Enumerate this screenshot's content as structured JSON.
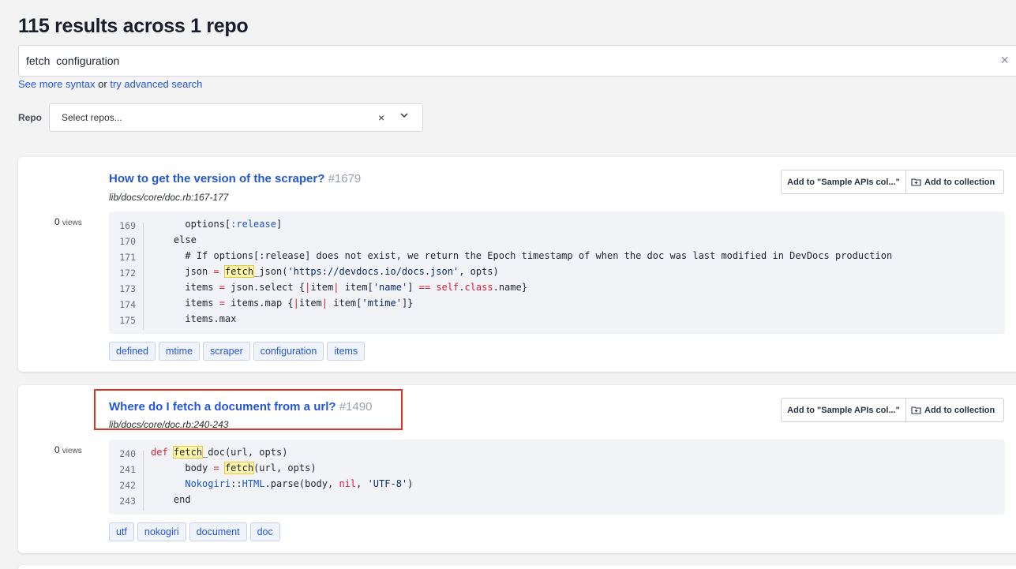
{
  "header": {
    "title": "115 results across 1 repo"
  },
  "search": {
    "value": "fetch  configuration",
    "clear_icon": "×"
  },
  "syntax": {
    "more": "See more syntax",
    "or": " or ",
    "advanced": "try advanced search"
  },
  "repo_filter": {
    "label": "Repo",
    "placeholder": "Select repos...",
    "clear": "×"
  },
  "results": [
    {
      "title": "How to get the version of the scraper?",
      "number": "#1679",
      "path": "lib/docs/core/doc.rb:167-177",
      "views_count": "0",
      "views_label": "views",
      "add_sample": "Add to \"Sample APIs col...\"",
      "add_collection": "Add to collection",
      "line_numbers": [
        "169",
        "170",
        "171",
        "172",
        "173",
        "174",
        "175"
      ],
      "tags": [
        "defined",
        "mtime",
        "scraper",
        "configuration",
        "items"
      ]
    },
    {
      "title": "Where do I fetch a document from a url?",
      "number": "#1490",
      "path": "lib/docs/core/doc.rb:240-243",
      "views_count": "0",
      "views_label": "views",
      "add_sample": "Add to \"Sample APIs col...\"",
      "add_collection": "Add to collection",
      "line_numbers": [
        "240",
        "241",
        "242",
        "243"
      ],
      "tags": [
        "utf",
        "nokogiri",
        "document",
        "doc"
      ]
    }
  ],
  "code": {
    "r1": {
      "l169_a": "      options[",
      "l169_b": ":release",
      "l169_c": "]",
      "l170": "    else",
      "l171": "      # If options[:release] does not exist, we return the Epoch timestamp of when the doc was last modified in DevDocs production",
      "l172_a": "      json ",
      "l172_b": "=",
      "l172_c": " ",
      "l172_d": "fetch",
      "l172_e": "_json(",
      "l172_f": "'https://devdocs.io/docs.json'",
      "l172_g": ", opts)",
      "l173_a": "      items ",
      "l173_b": "=",
      "l173_c": " json.select {",
      "l173_d": "|",
      "l173_e": "item",
      "l173_f": "|",
      "l173_g": " item[",
      "l173_h": "'name'",
      "l173_i": "] ",
      "l173_j": "==",
      "l173_k": " ",
      "l173_l": "self",
      "l173_m": ".",
      "l173_n": "class",
      "l173_o": ".name}",
      "l174_a": "      items ",
      "l174_b": "=",
      "l174_c": " items.map {",
      "l174_d": "|",
      "l174_e": "item",
      "l174_f": "|",
      "l174_g": " item[",
      "l174_h": "'mtime'",
      "l174_i": "]}",
      "l175": "      items.max"
    },
    "r2": {
      "l240_a": "def",
      "l240_b": " ",
      "l240_c": "fetch",
      "l240_d": "_doc(url, opts)",
      "l241_a": "      body ",
      "l241_b": "=",
      "l241_c": " ",
      "l241_d": "fetch",
      "l241_e": "(url, opts)",
      "l242_a": "      ",
      "l242_b": "Nokogiri",
      "l242_c": "::",
      "l242_d": "HTML",
      "l242_e": ".parse(body, ",
      "l242_f": "nil",
      "l242_g": ", ",
      "l242_h": "'UTF-8'",
      "l242_i": ")",
      "l243": "    end"
    }
  },
  "colors": {
    "link": "#2456d8",
    "keyword": "#d0213b",
    "highlight": "#fff6a8",
    "annotation_box": "#e0321f"
  }
}
